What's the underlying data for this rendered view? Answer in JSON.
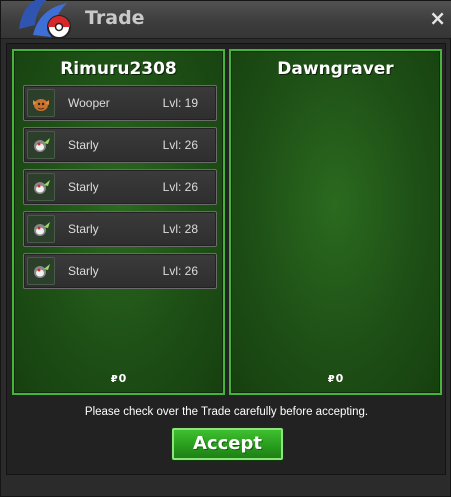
{
  "window": {
    "title": "Trade",
    "close_label": "×"
  },
  "left_panel": {
    "name": "Rimuru2308",
    "money": "0",
    "pokemon": [
      {
        "name": "Wooper",
        "level": "Lvl: 19",
        "icon": "wooper-icon"
      },
      {
        "name": "Starly",
        "level": "Lvl: 26",
        "icon": "starly-icon"
      },
      {
        "name": "Starly",
        "level": "Lvl: 26",
        "icon": "starly-icon"
      },
      {
        "name": "Starly",
        "level": "Lvl: 28",
        "icon": "starly-icon"
      },
      {
        "name": "Starly",
        "level": "Lvl: 26",
        "icon": "starly-icon"
      }
    ]
  },
  "right_panel": {
    "name": "Dawngraver",
    "money": "0"
  },
  "notice": "Please check over the Trade carefully before accepting.",
  "accept_label": "Accept",
  "colors": {
    "panel_border": "#46b33a",
    "panel_bg": "#1e5016",
    "accept_bg": "#279a1c"
  }
}
